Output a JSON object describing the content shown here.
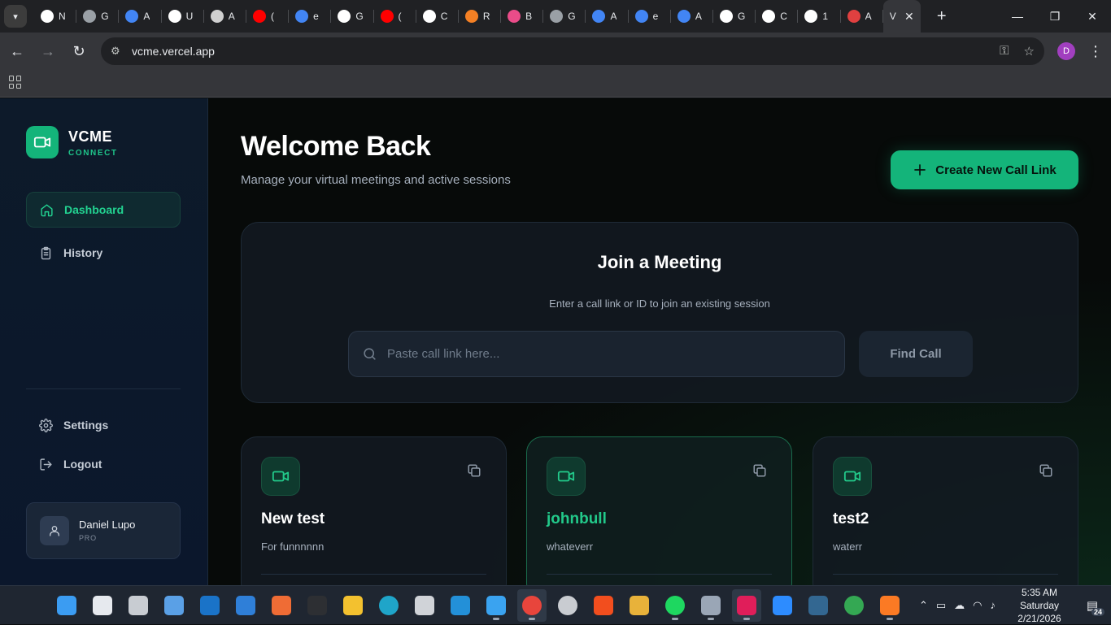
{
  "browser": {
    "tabs": [
      {
        "label": "N",
        "color": "#ffffff"
      },
      {
        "label": "G",
        "color": "#9aa0a6"
      },
      {
        "label": "A",
        "color": "#4285f4"
      },
      {
        "label": "U",
        "color": "#ffffff"
      },
      {
        "label": "A",
        "color": "#d0d0d0"
      },
      {
        "label": "(",
        "color": "#ff0000"
      },
      {
        "label": "e",
        "color": "#4285f4"
      },
      {
        "label": "G",
        "color": "#ffffff"
      },
      {
        "label": "(",
        "color": "#ff0000"
      },
      {
        "label": "C",
        "color": "#ffffff"
      },
      {
        "label": "R",
        "color": "#f48024"
      },
      {
        "label": "B",
        "color": "#ea4c89"
      },
      {
        "label": "G",
        "color": "#9aa0a6"
      },
      {
        "label": "A",
        "color": "#4285f4"
      },
      {
        "label": "e",
        "color": "#4285f4"
      },
      {
        "label": "A",
        "color": "#4285f4"
      },
      {
        "label": "G",
        "color": "#ffffff"
      },
      {
        "label": "C",
        "color": "#ffffff"
      },
      {
        "label": "1",
        "color": "#ffffff"
      },
      {
        "label": "A",
        "color": "#e04040"
      }
    ],
    "active_tab": {
      "label": "V",
      "color": "#ffffff"
    },
    "url": "vcme.vercel.app",
    "profile_initial": "D"
  },
  "sidebar": {
    "brand_name": "VCME",
    "brand_sub": "CONNECT",
    "items": [
      {
        "label": "Dashboard",
        "icon": "home-icon",
        "active": true
      },
      {
        "label": "History",
        "icon": "clipboard-icon",
        "active": false
      }
    ],
    "bottom_items": [
      {
        "label": "Settings",
        "icon": "gear-icon"
      },
      {
        "label": "Logout",
        "icon": "logout-icon"
      }
    ],
    "user": {
      "name": "Daniel Lupo",
      "plan": "PRO"
    }
  },
  "main": {
    "title": "Welcome Back",
    "subtitle": "Manage your virtual meetings and active sessions",
    "create_button": "Create New Call Link",
    "join": {
      "title": "Join a Meeting",
      "subtitle": "Enter a call link or ID to join an existing session",
      "placeholder": "Paste call link here...",
      "button": "Find Call"
    },
    "calls": [
      {
        "title": "New test",
        "description": "For funnnnnn",
        "highlighted": false
      },
      {
        "title": "johnbull",
        "description": "whateverr",
        "highlighted": true
      },
      {
        "title": "test2",
        "description": "waterr",
        "highlighted": false
      }
    ]
  },
  "taskbar": {
    "time": "5:35 AM",
    "day": "Saturday",
    "date": "2/21/2026",
    "notification_count": "24",
    "apps": [
      {
        "name": "start-icon",
        "color": "#3b9cf2"
      },
      {
        "name": "search-icon",
        "color": "#e6e9ee"
      },
      {
        "name": "task-view-icon",
        "color": "#c8ccd2"
      },
      {
        "name": "widgets-icon",
        "color": "#5aa0e6"
      },
      {
        "name": "outlook-icon",
        "color": "#1a73c8"
      },
      {
        "name": "store-icon",
        "color": "#2f7fd8"
      },
      {
        "name": "postman-icon",
        "color": "#ef6c35"
      },
      {
        "name": "terminal-icon",
        "color": "#2d2f33"
      },
      {
        "name": "file-explorer-icon",
        "color": "#f3c12f"
      },
      {
        "name": "edge-icon",
        "color": "#1fa5c9"
      },
      {
        "name": "cube-icon",
        "color": "#d0d3d8"
      },
      {
        "name": "vscode-icon",
        "color": "#2390d8"
      },
      {
        "name": "arc-icon",
        "color": "#3aa3f0"
      },
      {
        "name": "chrome-icon",
        "color": "#e8453c"
      },
      {
        "name": "media-icon",
        "color": "#c9ccd1"
      },
      {
        "name": "figma-icon",
        "color": "#f24e1e"
      },
      {
        "name": "git-icon",
        "color": "#e8b23a"
      },
      {
        "name": "spotify-icon",
        "color": "#1ed760"
      },
      {
        "name": "settings-icon",
        "color": "#9aa6b6"
      },
      {
        "name": "slack-icon",
        "color": "#e01e5a"
      },
      {
        "name": "zoom-icon",
        "color": "#2d8cff"
      },
      {
        "name": "postgres-icon",
        "color": "#336791"
      },
      {
        "name": "chrome-alt-icon",
        "color": "#34a853"
      },
      {
        "name": "xampp-icon",
        "color": "#fb7a24"
      }
    ]
  },
  "colors": {
    "accent": "#14b47a",
    "accent_text": "#22d391"
  }
}
